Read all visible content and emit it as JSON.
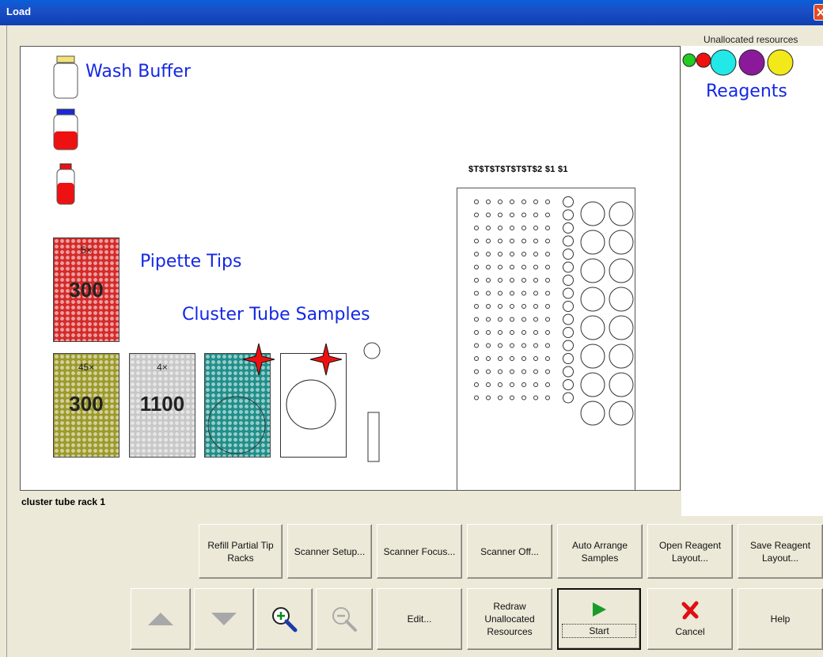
{
  "window": {
    "title": "Load"
  },
  "header": {
    "unallocated_label": "Unallocated resources"
  },
  "labels": {
    "wash_buffer": "Wash Buffer",
    "reagents": "Reagents",
    "pipette_tips": "Pipette Tips",
    "cluster_tube_samples": "Cluster Tube Samples"
  },
  "racks": [
    {
      "count": "5×",
      "value": "300",
      "color": "#d42a2a"
    },
    {
      "count": "45×",
      "value": "300",
      "color": "#9c9a2a"
    },
    {
      "count": "4×",
      "value": "1100",
      "color": "#c8c8c8"
    }
  ],
  "tube_rack": {
    "column_labels": "$T$T$T$T$T$T$2  $1   $1"
  },
  "reagent_colors": [
    "#22cc22",
    "#ee1111",
    "#22e8e8",
    "#8a1a9a",
    "#f2e81a"
  ],
  "status": {
    "selected": "cluster tube rack 1"
  },
  "buttons": {
    "refill": "Refill Partial Tip Racks",
    "scanner_setup": "Scanner Setup...",
    "scanner_focus": "Scanner Focus...",
    "scanner_off": "Scanner Off...",
    "auto_arrange": "Auto Arrange Samples",
    "open_layout": "Open Reagent Layout...",
    "save_layout": "Save Reagent Layout...",
    "edit": "Edit...",
    "redraw": "Redraw Unallocated Resources",
    "start": "Start",
    "cancel": "Cancel",
    "help": "Help"
  }
}
